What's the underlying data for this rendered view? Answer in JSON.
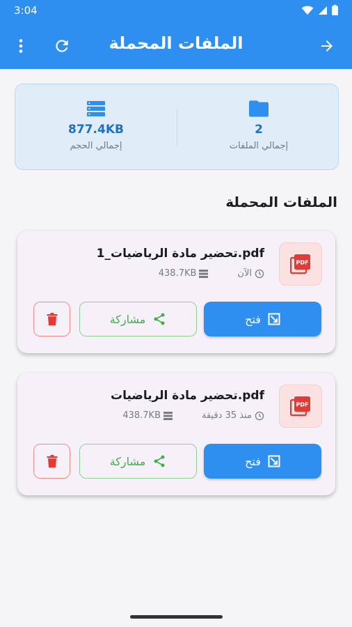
{
  "status": {
    "time": "3:04"
  },
  "toolbar": {
    "title": "الملفات المحملة",
    "menu_icon": "more-vert-icon",
    "refresh_icon": "refresh-icon",
    "back_icon": "arrow-forward-icon"
  },
  "summary": {
    "total_files_value": "2",
    "total_files_label": "إجمالي الملفات",
    "total_size_value": "877.4KB",
    "total_size_label": "إجمالي الحجم"
  },
  "section": {
    "title": "الملفات المحملة"
  },
  "files": [
    {
      "name": "تحضير مادة الرياضيات_1.pdf",
      "time": "الآن",
      "size": "438.7KB",
      "open_label": "فتح",
      "share_label": "مشاركة"
    },
    {
      "name": "تحضير مادة الرياضيات.pdf",
      "time": "منذ 35 دقيقة",
      "size": "438.7KB",
      "open_label": "فتح",
      "share_label": "مشاركة"
    }
  ],
  "colors": {
    "primary": "#2f8ff0",
    "share_green": "#3fae49",
    "delete_red": "#e53935",
    "pdf_red": "#e53935"
  }
}
